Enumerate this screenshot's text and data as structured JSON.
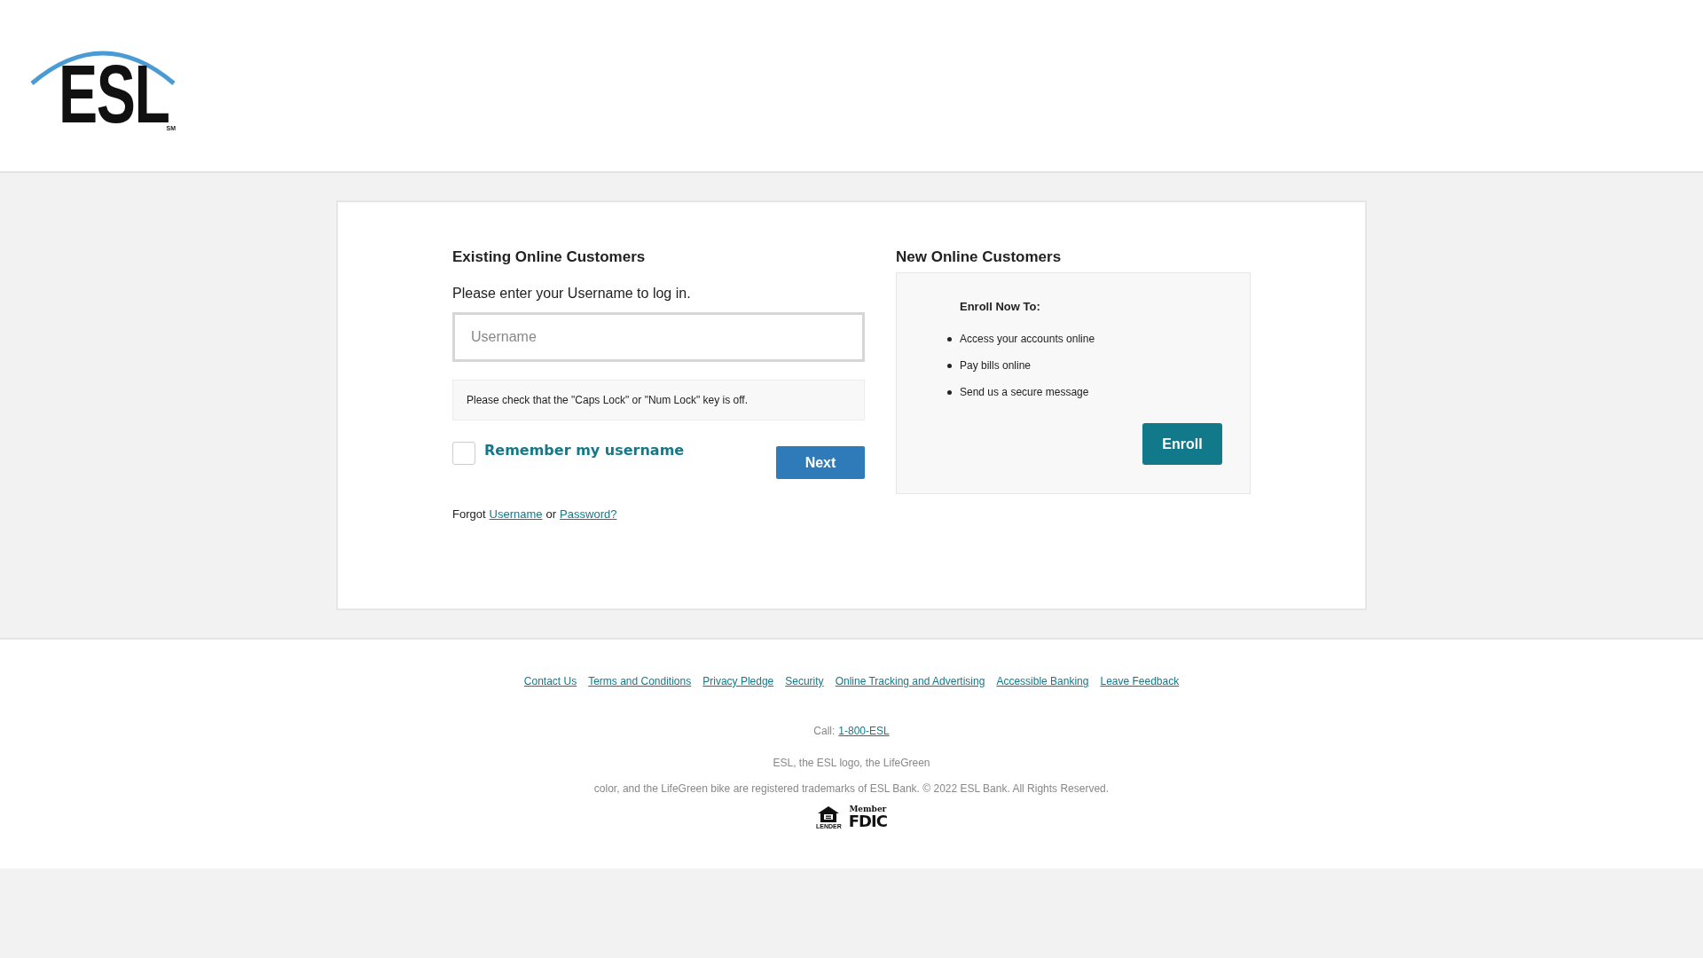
{
  "header": {
    "logo": {
      "text": "ESL",
      "mark": "SM"
    }
  },
  "existing": {
    "title": "Existing Online Customers",
    "prompt": "Please enter your Username to log in.",
    "username": {
      "placeholder": "Username"
    },
    "notice": "Please check that the \"Caps Lock\" or \"Num Lock\" key is off.",
    "remember": {
      "label": "Remember my username",
      "checked": false
    },
    "next_button": "Next",
    "forgot": {
      "prefix": "Forgot",
      "username_link": "Username",
      "joiner": "or",
      "password_link": "Password?"
    }
  },
  "new": {
    "title": "New Online Customers",
    "box_title": "Enroll Now To:",
    "benefits": [
      "Access your accounts online",
      "Pay bills online",
      "Send us a secure message"
    ],
    "enroll_button": "Enroll"
  },
  "footer": {
    "links": [
      "Contact Us",
      "Terms and Conditions",
      "Privacy Pledge",
      "Security",
      "Online Tracking and Advertising",
      "Accessible Banking",
      "Leave Feedback"
    ],
    "call": {
      "label": "Call:",
      "phone": "1-800-ESL"
    },
    "legal": [
      "ESL, the ESL logo, the LifeGreen",
      "color, and the LifeGreen bike are registered trademarks of ESL Bank. © 2022 ESL Bank. All Rights Reserved."
    ],
    "badges": {
      "lender": "LENDER",
      "member": "Member",
      "fdic": "FDIC"
    }
  }
}
